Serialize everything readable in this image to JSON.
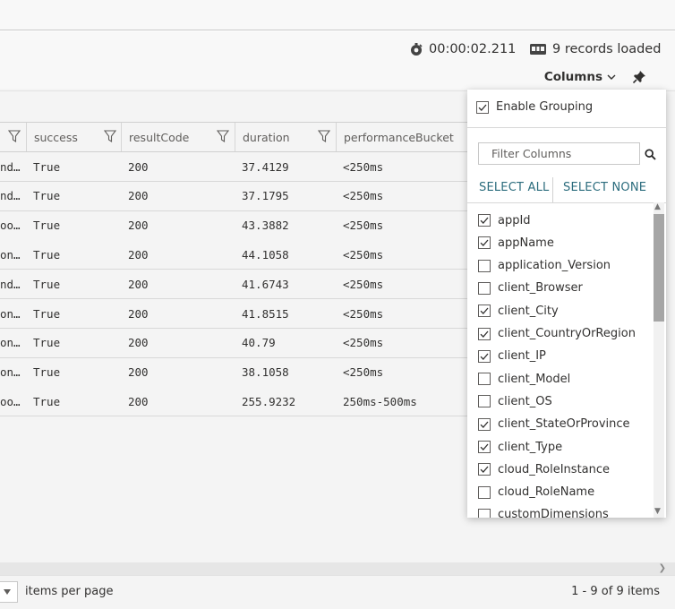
{
  "status": {
    "duration": "00:00:02.211",
    "records": "9 records loaded"
  },
  "toolbar": {
    "columns_label": "Columns"
  },
  "headers": [
    "success",
    "resultCode",
    "duration",
    "performanceBucket"
  ],
  "rows": [
    {
      "prefix": "nd…",
      "success": "True",
      "resultCode": "200",
      "duration": "37.4129",
      "bucket": "<250ms"
    },
    {
      "prefix": "nd…",
      "success": "True",
      "resultCode": "200",
      "duration": "37.1795",
      "bucket": "<250ms"
    },
    {
      "prefix": "oo…",
      "success": "True",
      "resultCode": "200",
      "duration": "43.3882",
      "bucket": "<250ms"
    },
    {
      "prefix": "on…",
      "success": "True",
      "resultCode": "200",
      "duration": "44.1058",
      "bucket": "<250ms"
    },
    {
      "prefix": "nd…",
      "success": "True",
      "resultCode": "200",
      "duration": "41.6743",
      "bucket": "<250ms"
    },
    {
      "prefix": "on…",
      "success": "True",
      "resultCode": "200",
      "duration": "41.8515",
      "bucket": "<250ms"
    },
    {
      "prefix": "on…",
      "success": "True",
      "resultCode": "200",
      "duration": "40.79",
      "bucket": "<250ms"
    },
    {
      "prefix": "on…",
      "success": "True",
      "resultCode": "200",
      "duration": "38.1058",
      "bucket": "<250ms"
    },
    {
      "prefix": "oo…",
      "success": "True",
      "resultCode": "200",
      "duration": "255.9232",
      "bucket": "250ms-500ms"
    }
  ],
  "panel": {
    "enable_grouping": "Enable Grouping",
    "enable_grouping_checked": true,
    "filter_placeholder": "Filter Columns",
    "select_all": "SELECT ALL",
    "select_none": "SELECT NONE",
    "columns": [
      {
        "name": "appId",
        "checked": true
      },
      {
        "name": "appName",
        "checked": true
      },
      {
        "name": "application_Version",
        "checked": false
      },
      {
        "name": "client_Browser",
        "checked": false
      },
      {
        "name": "client_City",
        "checked": true
      },
      {
        "name": "client_CountryOrRegion",
        "checked": true
      },
      {
        "name": "client_IP",
        "checked": true
      },
      {
        "name": "client_Model",
        "checked": false
      },
      {
        "name": "client_OS",
        "checked": false
      },
      {
        "name": "client_StateOrProvince",
        "checked": true
      },
      {
        "name": "client_Type",
        "checked": true
      },
      {
        "name": "cloud_RoleInstance",
        "checked": true
      },
      {
        "name": "cloud_RoleName",
        "checked": false
      },
      {
        "name": "customDimensions",
        "checked": false
      }
    ]
  },
  "footer": {
    "items_per_page": "items per page",
    "paging": "1 - 9 of 9 items"
  }
}
